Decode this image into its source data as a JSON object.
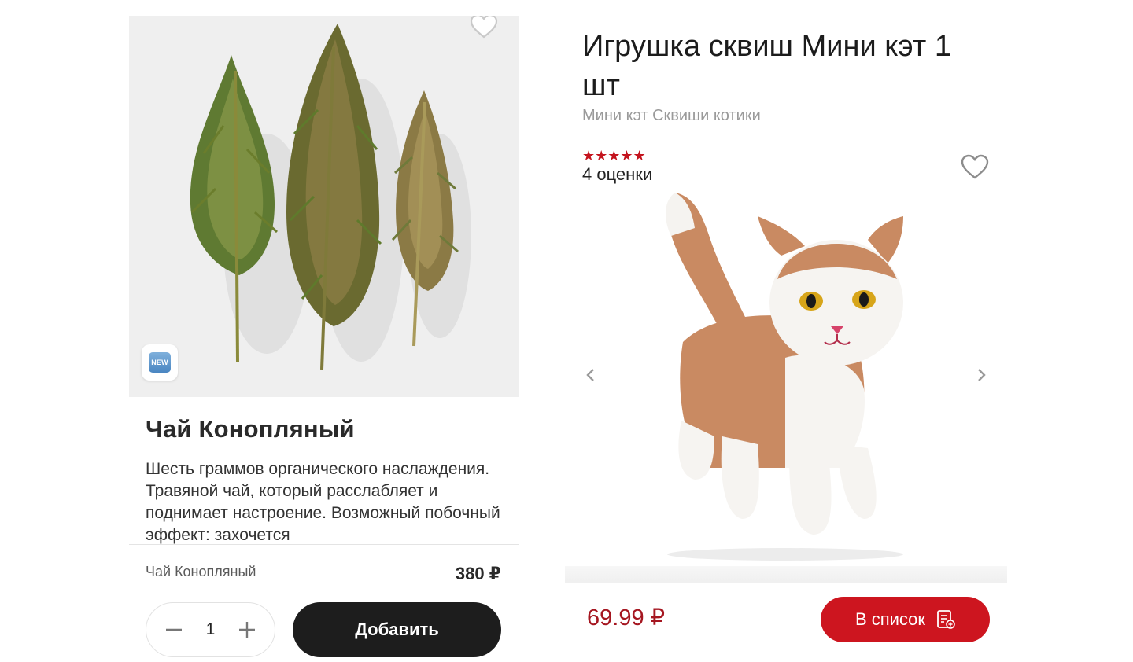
{
  "left_card": {
    "new_badge": "NEW",
    "title": "Чай Конопляный",
    "description": "Шесть граммов органического наслаждения. Травяной чай, который расслабляет и поднимает настроение. Возможный побочный эффект: захочется",
    "caption": "Чай Конопляный",
    "price": "380 ₽",
    "quantity": "1",
    "minus_label": "−",
    "plus_label": "+",
    "add_button_label": "Добавить",
    "favorite_icon": "heart-outline-icon"
  },
  "right_card": {
    "title": "Игрушка сквиш Мини кэт 1 шт",
    "subtitle": "Мини кэт Сквиши котики",
    "stars": "★★★★★",
    "rating": 5,
    "reviews": "4 оценки",
    "price": "69.99 ₽",
    "list_button_label": "В список",
    "favorite_icon": "heart-outline-icon",
    "prev_icon": "chevron-left-icon",
    "next_icon": "chevron-right-icon"
  },
  "colors": {
    "accent_red": "#cd151f",
    "price_red": "#a51620",
    "dark_button": "#1d1d1d",
    "star_red": "#c4141e"
  }
}
